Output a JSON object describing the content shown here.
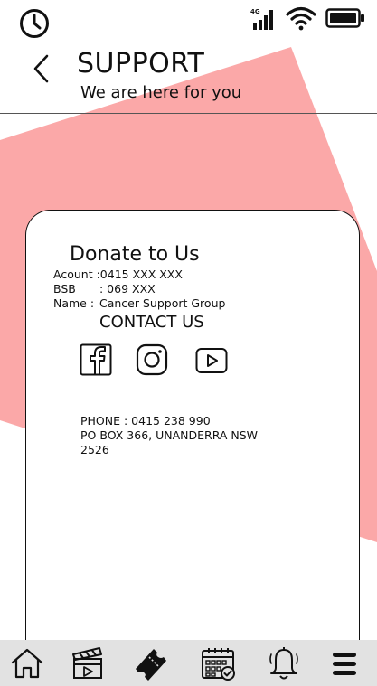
{
  "status_bar": {
    "network": "4G",
    "icons": [
      "clock-icon",
      "signal-icon",
      "wifi-icon",
      "battery-icon"
    ]
  },
  "header": {
    "back_icon": "chevron-left-icon",
    "title": "SUPPORT",
    "subtitle": "We are here for you"
  },
  "donate": {
    "title": "Donate to Us",
    "rows": [
      {
        "label": "Acount : ",
        "value": "0415 XXX XXX"
      },
      {
        "label": "BSB",
        "value": ": 069 XXX"
      },
      {
        "label": "Name : ",
        "value": " Cancer Support Group"
      }
    ]
  },
  "contact": {
    "title": "CONTACT US",
    "social": [
      "facebook-icon",
      "instagram-icon",
      "youtube-icon"
    ],
    "phone": "PHONE : 0415 238 990",
    "address_line1": "PO BOX 366, UNANDERRA NSW",
    "address_line2": "2526"
  },
  "bottom_nav": {
    "items": [
      "home-icon",
      "clapperboard-icon",
      "ticket-icon",
      "calendar-icon",
      "bell-icon",
      "menu-icon"
    ]
  },
  "colors": {
    "accent_shape": "#fba8a8",
    "nav_background": "#e2e2e2",
    "text": "#111111"
  }
}
